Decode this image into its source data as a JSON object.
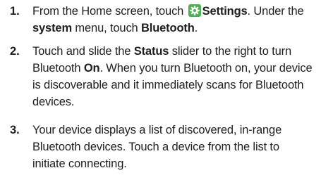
{
  "steps": [
    {
      "number": "1.",
      "line1_a": "From the Home screen, touch ",
      "settings_label": "Settings",
      "line1_b": ". Under the",
      "system_label": "system",
      "line2_a": " menu, touch ",
      "bluetooth_label": "Bluetooth",
      "line2_b": ".",
      "icon": "settings-gear-icon",
      "icon_color": "#4caf50"
    },
    {
      "number": "2.",
      "line1_a": "Touch and slide the ",
      "status_label": "Status",
      "line1_b": " slider to the right to turn",
      "line2_a": "Bluetooth ",
      "on_label": "On",
      "line2_b": ". When you turn Bluetooth on, your device",
      "line3": "is discoverable and it immediately scans for Bluetooth",
      "line4": "devices."
    },
    {
      "number": "3.",
      "line1": "Your device displays a list of discovered, in-range",
      "line2": "Bluetooth devices. Touch a device from the list to",
      "line3": "initiate connecting."
    }
  ]
}
